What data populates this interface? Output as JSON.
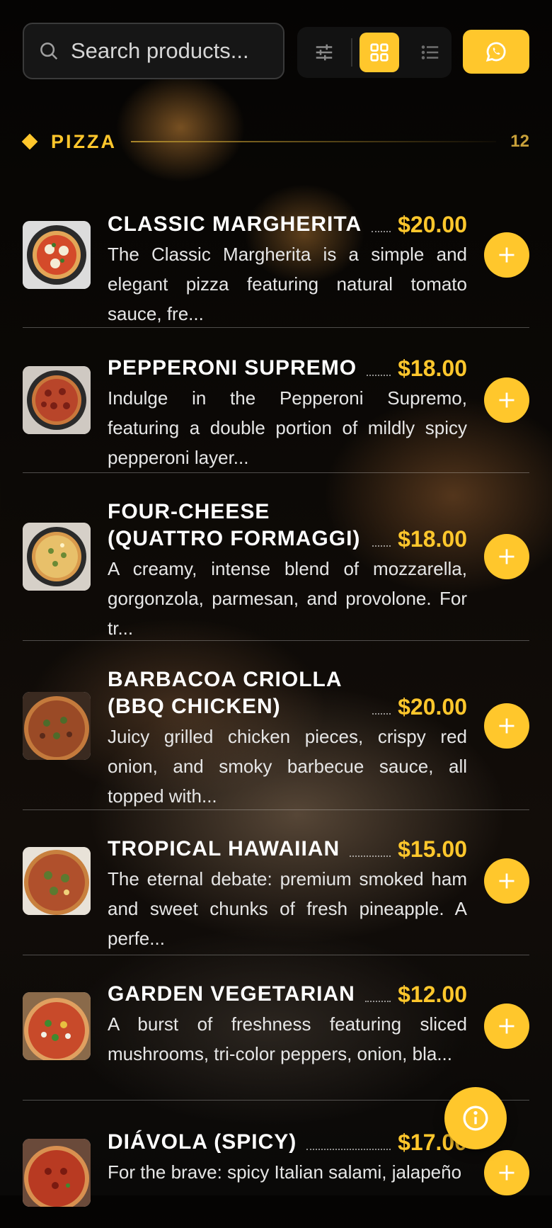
{
  "search": {
    "placeholder": "Search products..."
  },
  "toolbar": {
    "filter_icon": "sliders-icon",
    "grid_icon": "grid-view-icon",
    "list_icon": "list-view-icon",
    "whatsapp_icon": "whatsapp-icon",
    "accent": "#ffc72c"
  },
  "section": {
    "title": "PIZZA",
    "count": "12"
  },
  "products": [
    {
      "name": "CLASSIC MARGHERITA",
      "price": "$20.00",
      "description": "The Classic Margherita is a simple and elegant pizza featuring natural tomato sauce, fre..."
    },
    {
      "name": "PEPPERONI SUPREMO",
      "price": "$18.00",
      "description": "Indulge in the Pepperoni Supremo, featuring a double portion of mildly spicy pepperoni layer..."
    },
    {
      "name": "FOUR-CHEESE (QUATTRO FORMAGGI)",
      "price": "$18.00",
      "description": "A creamy, intense blend of mozzarella, gorgonzola, parmesan, and provolone. For tr..."
    },
    {
      "name": "BARBACOA CRIOLLA (BBQ CHICKEN)",
      "price": "$20.00",
      "description": "Juicy grilled chicken pieces, crispy red onion, and smoky barbecue sauce, all topped with..."
    },
    {
      "name": "TROPICAL HAWAIIAN",
      "price": "$15.00",
      "description": "The eternal debate: premium smoked ham and sweet chunks of fresh pineapple. A perfe..."
    },
    {
      "name": "GARDEN VEGETARIAN",
      "price": "$12.00",
      "description": "A burst of freshness featuring sliced mushrooms, tri-color peppers, onion, bla..."
    },
    {
      "name": "DIÁVOLA (SPICY)",
      "price": "$17.00",
      "description": "For the brave: spicy Italian salami, jalapeño"
    }
  ],
  "fab": {
    "icon": "info-icon"
  }
}
